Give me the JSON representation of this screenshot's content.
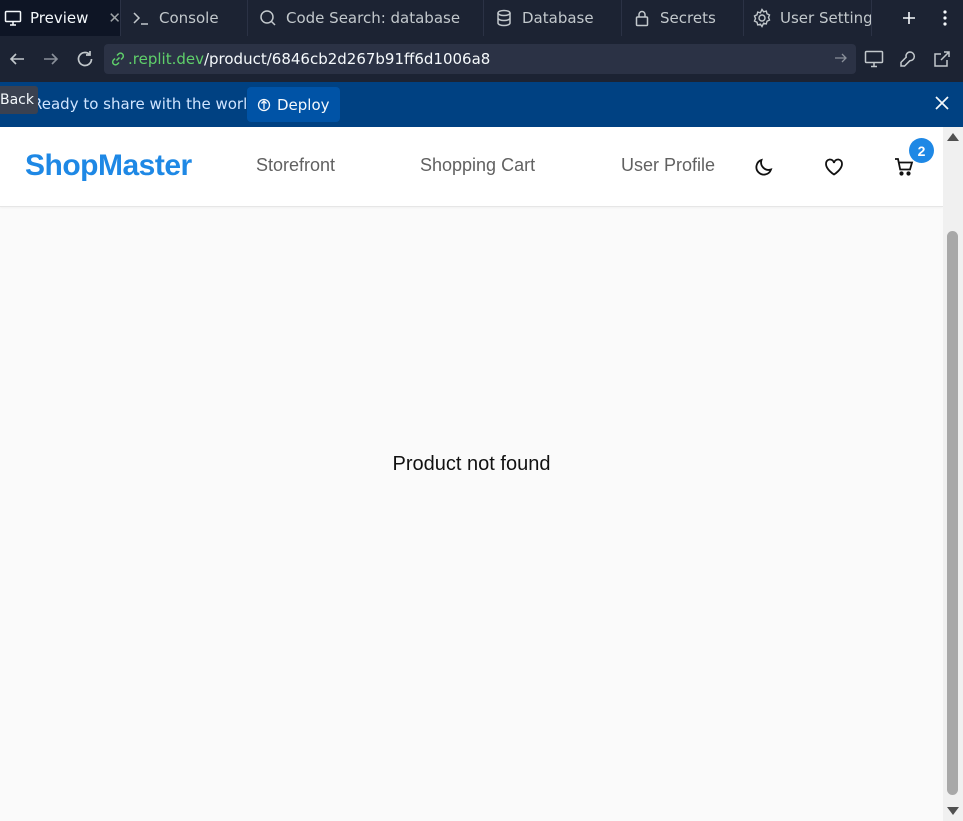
{
  "tabs": [
    {
      "label": "Preview",
      "icon": "monitor-icon",
      "active": true,
      "closable": true
    },
    {
      "label": "Console",
      "icon": "terminal-icon"
    },
    {
      "label": "Code Search: database",
      "icon": "search-icon"
    },
    {
      "label": "Database",
      "icon": "database-icon"
    },
    {
      "label": "Secrets",
      "icon": "lock-icon"
    },
    {
      "label": "User Setting",
      "icon": "gear-icon"
    }
  ],
  "tab_actions": {
    "new_tab": "+",
    "more": "⋮"
  },
  "address_bar": {
    "host": ".replit.dev",
    "path": "/product/6846cb2d267b91ff6d1006a8"
  },
  "banner": {
    "text": "Ready to share with the world?",
    "deploy_label": "Deploy",
    "back_tooltip": "Back"
  },
  "site": {
    "logo": "ShopMaster",
    "nav": [
      "Storefront",
      "Shopping Cart",
      "User Profile"
    ],
    "cart_count": "2",
    "accent_color": "#1e88e5",
    "message": "Product not found"
  }
}
